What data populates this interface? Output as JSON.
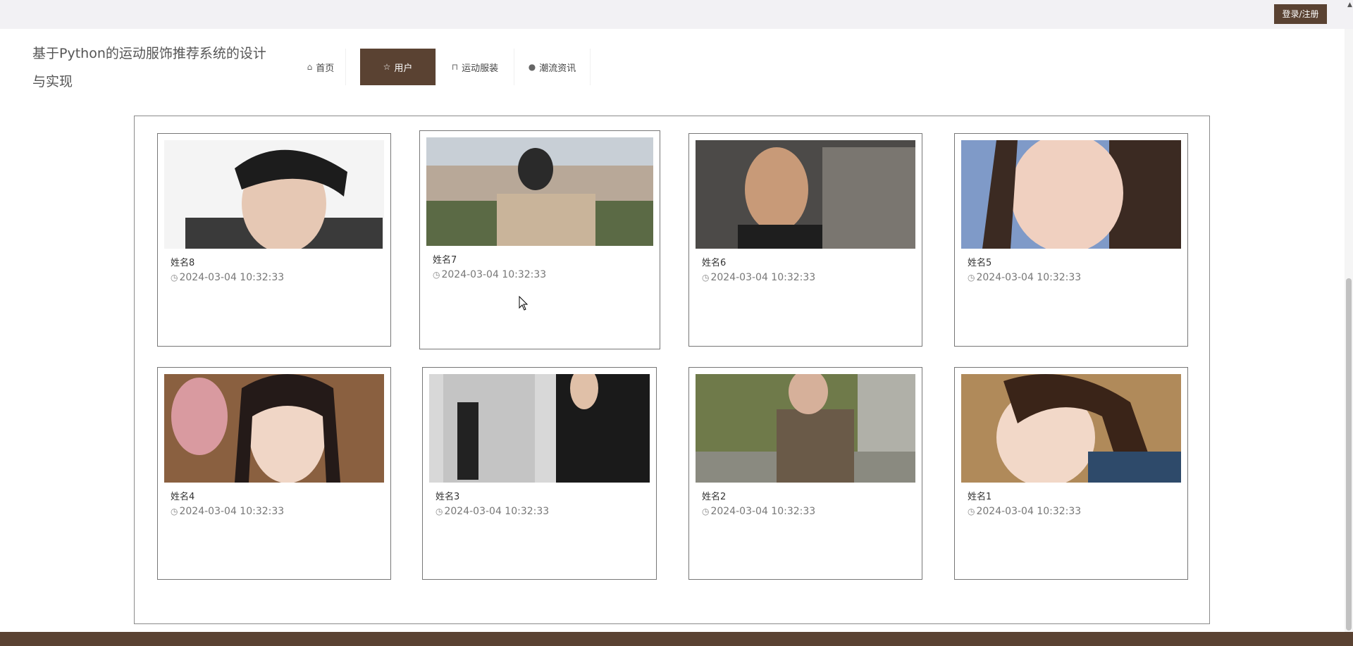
{
  "header": {
    "login_label": "登录/注册",
    "site_title": "基于Python的运动服饰推荐系统的设计与实现"
  },
  "nav": {
    "home": "首页",
    "users": "用户",
    "clothing": "运动服装",
    "news": "潮流资讯"
  },
  "icons": {
    "home": "home-icon",
    "users": "star-icon",
    "clothing": "bag-icon",
    "news": "info-icon",
    "time": "clock-icon"
  },
  "colors": {
    "accent": "#5a4232",
    "topbar": "#f2f1f4"
  },
  "cards": [
    {
      "name": "姓名8",
      "time": "2024-03-04 10:32:33"
    },
    {
      "name": "姓名7",
      "time": "2024-03-04 10:32:33"
    },
    {
      "name": "姓名6",
      "time": "2024-03-04 10:32:33"
    },
    {
      "name": "姓名5",
      "time": "2024-03-04 10:32:33"
    },
    {
      "name": "姓名4",
      "time": "2024-03-04 10:32:33"
    },
    {
      "name": "姓名3",
      "time": "2024-03-04 10:32:33"
    },
    {
      "name": "姓名2",
      "time": "2024-03-04 10:32:33"
    },
    {
      "name": "姓名1",
      "time": "2024-03-04 10:32:33"
    }
  ]
}
